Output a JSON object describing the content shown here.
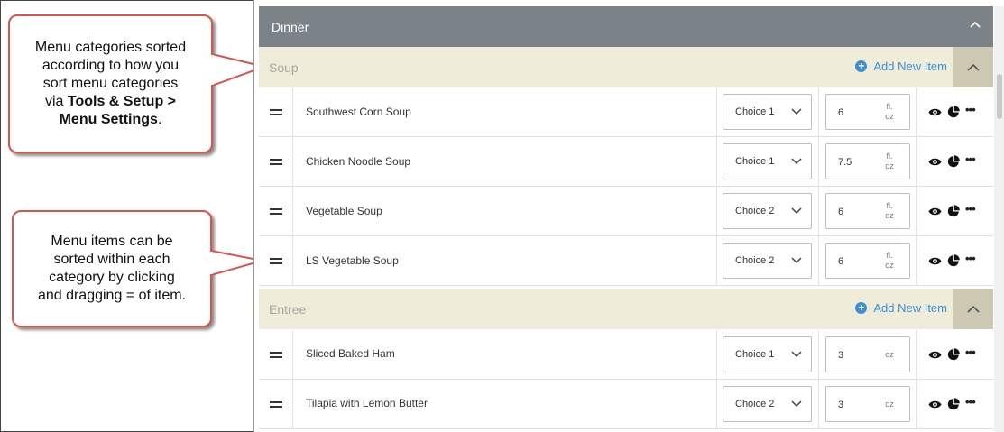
{
  "callouts": {
    "sort_categories": {
      "lines": [
        "Menu categories sorted",
        "according to how you",
        "sort menu categories"
      ],
      "via": "via",
      "bold1": "Tools & Setup >",
      "bold2": "Menu Settings",
      "end": "."
    },
    "sort_items": {
      "lines": [
        "Menu items can be",
        "sorted within each",
        "category by clicking",
        "and dragging = of item."
      ]
    }
  },
  "meal": {
    "title": "Dinner"
  },
  "categories": [
    {
      "name": "Soup",
      "add_label": "Add New Item",
      "items": [
        {
          "name": "Southwest Corn Soup",
          "choice": "Choice 1",
          "qty": "6",
          "unit_top": "fl.",
          "unit_bottom": "oz"
        },
        {
          "name": "Chicken Noodle Soup",
          "choice": "Choice 1",
          "qty": "7.5",
          "unit_top": "fl.",
          "unit_bottom": "oz"
        },
        {
          "name": "Vegetable Soup",
          "choice": "Choice 2",
          "qty": "6",
          "unit_top": "fl.",
          "unit_bottom": "oz"
        },
        {
          "name": "LS Vegetable Soup",
          "choice": "Choice 2",
          "qty": "6",
          "unit_top": "fl.",
          "unit_bottom": "oz"
        }
      ]
    },
    {
      "name": "Entree",
      "add_label": "Add New Item",
      "items": [
        {
          "name": "Sliced Baked Ham",
          "choice": "Choice 1",
          "qty": "3",
          "unit_top": "",
          "unit_bottom": "oz"
        },
        {
          "name": "Tilapia with Lemon Butter",
          "choice": "Choice 2",
          "qty": "3",
          "unit_top": "",
          "unit_bottom": "oz"
        }
      ]
    }
  ],
  "icons": [
    "drag-handle-icon",
    "chevron-down-icon",
    "chevron-up-icon",
    "plus-circle-icon",
    "eye-icon",
    "pie-chart-icon",
    "more-icon"
  ],
  "colors": {
    "header": "#7b8288",
    "category_bg": "#efecd9",
    "accent": "#3b8fd0",
    "callout_border": "#d9534f"
  }
}
